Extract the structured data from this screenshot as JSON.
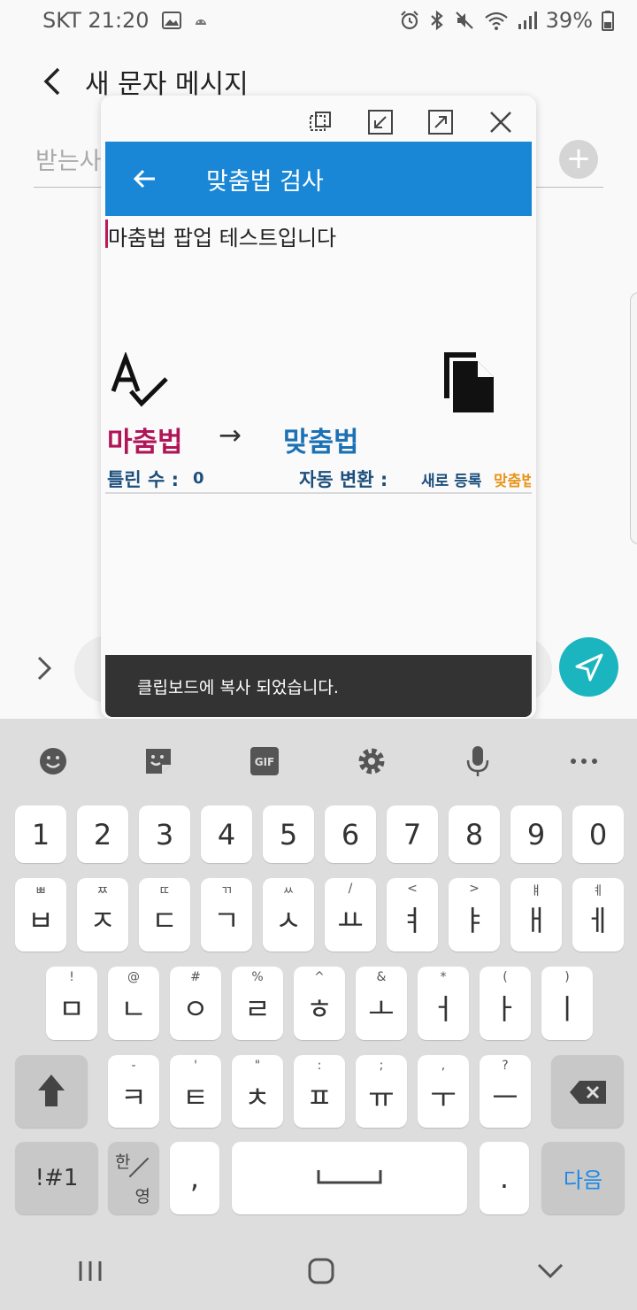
{
  "status_bar": {
    "carrier_time": "SKT 21:20",
    "battery": "39%"
  },
  "app": {
    "title": "새 문자 메시지",
    "recipient_placeholder": "받는사람"
  },
  "popup": {
    "title": "맞춤법 검사",
    "input_text": "마춤법 팝업 테스트입니다",
    "wrong_word": "마춤법",
    "arrow": "→",
    "correct_word": "맞춤법",
    "error_label": "틀린 수 :",
    "error_count": "0",
    "auto_convert_label": "자동 변환 :",
    "register_link": "새로 등록",
    "register_word": "맞춤법",
    "toast": "클립보드에 복사 되었습니다."
  },
  "keyboard": {
    "number_row": [
      "1",
      "2",
      "3",
      "4",
      "5",
      "6",
      "7",
      "8",
      "9",
      "0"
    ],
    "row1": [
      {
        "main": "ㅂ",
        "sub": "ㅃ"
      },
      {
        "main": "ㅈ",
        "sub": "ㅉ"
      },
      {
        "main": "ㄷ",
        "sub": "ㄸ"
      },
      {
        "main": "ㄱ",
        "sub": "ㄲ"
      },
      {
        "main": "ㅅ",
        "sub": "ㅆ"
      },
      {
        "main": "ㅛ",
        "sub": "/"
      },
      {
        "main": "ㅕ",
        "sub": "<"
      },
      {
        "main": "ㅑ",
        "sub": ">"
      },
      {
        "main": "ㅐ",
        "sub": "ㅒ"
      },
      {
        "main": "ㅔ",
        "sub": "ㅖ"
      }
    ],
    "row2": [
      {
        "main": "ㅁ",
        "sub": "!"
      },
      {
        "main": "ㄴ",
        "sub": "@"
      },
      {
        "main": "ㅇ",
        "sub": "#"
      },
      {
        "main": "ㄹ",
        "sub": "%"
      },
      {
        "main": "ㅎ",
        "sub": "^"
      },
      {
        "main": "ㅗ",
        "sub": "&"
      },
      {
        "main": "ㅓ",
        "sub": "*"
      },
      {
        "main": "ㅏ",
        "sub": "("
      },
      {
        "main": "ㅣ",
        "sub": ")"
      }
    ],
    "row3": [
      {
        "main": "ㅋ",
        "sub": "-"
      },
      {
        "main": "ㅌ",
        "sub": "'"
      },
      {
        "main": "ㅊ",
        "sub": "\""
      },
      {
        "main": "ㅍ",
        "sub": ":"
      },
      {
        "main": "ㅠ",
        "sub": ";"
      },
      {
        "main": "ㅜ",
        "sub": ","
      },
      {
        "main": "ㅡ",
        "sub": "?"
      }
    ],
    "symbols_key": "!#1",
    "lang_top": "한",
    "lang_bottom": "영",
    "comma_key": ",",
    "period_key": ".",
    "enter_key": "다음"
  }
}
